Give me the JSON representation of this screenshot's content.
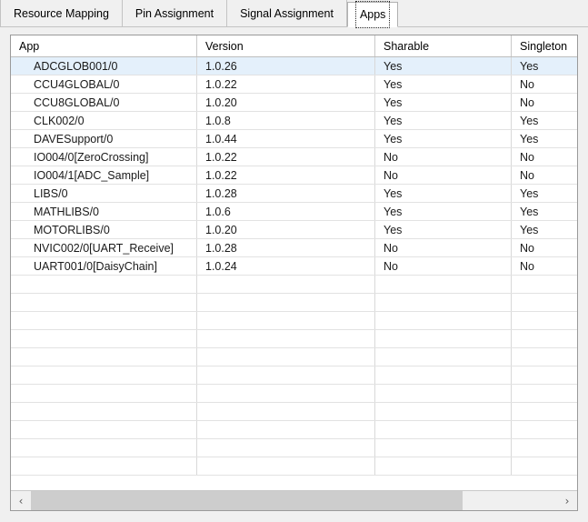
{
  "tabs": [
    {
      "label": "Resource Mapping",
      "selected": false
    },
    {
      "label": "Pin Assignment",
      "selected": false
    },
    {
      "label": "Signal Assignment",
      "selected": false
    },
    {
      "label": "Apps",
      "selected": true
    }
  ],
  "table": {
    "columns": [
      "App",
      "Version",
      "Sharable",
      "Singleton"
    ],
    "rows": [
      {
        "app": "ADCGLOB001/0",
        "version": "1.0.26",
        "sharable": "Yes",
        "singleton": "Yes",
        "selected": true
      },
      {
        "app": "CCU4GLOBAL/0",
        "version": "1.0.22",
        "sharable": "Yes",
        "singleton": "No",
        "selected": false
      },
      {
        "app": "CCU8GLOBAL/0",
        "version": "1.0.20",
        "sharable": "Yes",
        "singleton": "No",
        "selected": false
      },
      {
        "app": "CLK002/0",
        "version": "1.0.8",
        "sharable": "Yes",
        "singleton": "Yes",
        "selected": false
      },
      {
        "app": "DAVESupport/0",
        "version": "1.0.44",
        "sharable": "Yes",
        "singleton": "Yes",
        "selected": false
      },
      {
        "app": "IO004/0[ZeroCrossing]",
        "version": "1.0.22",
        "sharable": "No",
        "singleton": "No",
        "selected": false
      },
      {
        "app": "IO004/1[ADC_Sample]",
        "version": "1.0.22",
        "sharable": "No",
        "singleton": "No",
        "selected": false
      },
      {
        "app": "LIBS/0",
        "version": "1.0.28",
        "sharable": "Yes",
        "singleton": "Yes",
        "selected": false
      },
      {
        "app": "MATHLIBS/0",
        "version": "1.0.6",
        "sharable": "Yes",
        "singleton": "Yes",
        "selected": false
      },
      {
        "app": "MOTORLIBS/0",
        "version": "1.0.20",
        "sharable": "Yes",
        "singleton": "Yes",
        "selected": false
      },
      {
        "app": "NVIC002/0[UART_Receive]",
        "version": "1.0.28",
        "sharable": "No",
        "singleton": "No",
        "selected": false
      },
      {
        "app": "UART001/0[DaisyChain]",
        "version": "1.0.24",
        "sharable": "No",
        "singleton": "No",
        "selected": false
      }
    ],
    "empty_row_count": 11
  },
  "scrollbar": {
    "left_arrow": "‹",
    "right_arrow": "›",
    "thumb_fraction": 0.82
  },
  "colors": {
    "selection": "#e4f0fb",
    "panel": "#f0f0f0",
    "grid_line": "#e2e2e2",
    "border": "#9a9a9a",
    "thumb": "#cdcdcd"
  }
}
